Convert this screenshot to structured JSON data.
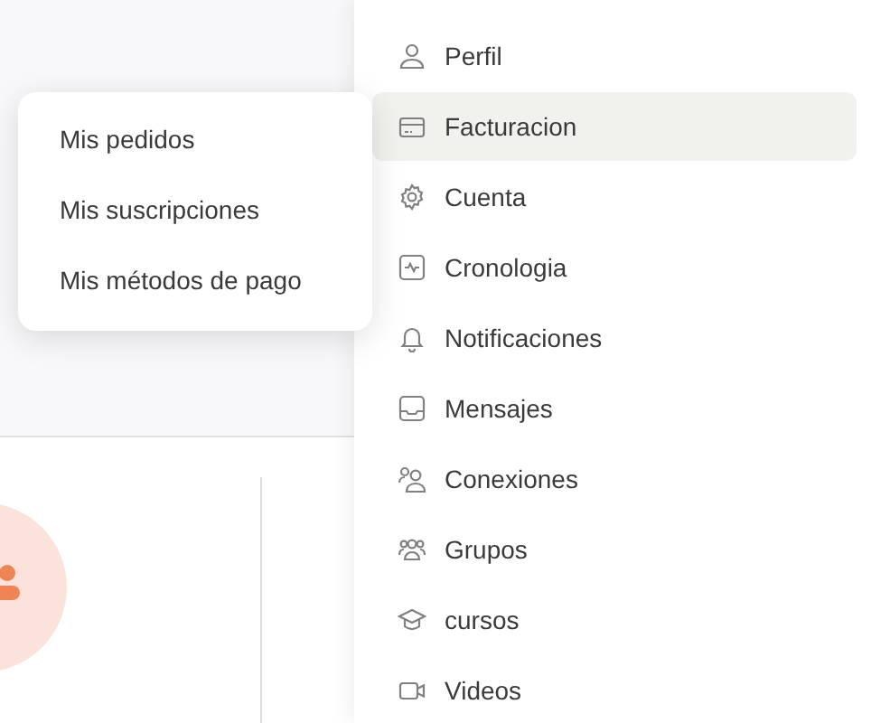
{
  "dropdown_menu": {
    "items": [
      {
        "label": "Mis pedidos"
      },
      {
        "label": "Mis suscripciones"
      },
      {
        "label": "Mis métodos de pago"
      }
    ]
  },
  "sidebar": {
    "items": [
      {
        "label": "Perfil",
        "selected": false
      },
      {
        "label": "Facturacion",
        "selected": true
      },
      {
        "label": "Cuenta",
        "selected": false
      },
      {
        "label": "Cronologia",
        "selected": false
      },
      {
        "label": "Notificaciones",
        "selected": false
      },
      {
        "label": "Mensajes",
        "selected": false
      },
      {
        "label": "Conexiones",
        "selected": false
      },
      {
        "label": "Grupos",
        "selected": false
      },
      {
        "label": "cursos",
        "selected": false
      },
      {
        "label": "Videos",
        "selected": false
      }
    ]
  }
}
